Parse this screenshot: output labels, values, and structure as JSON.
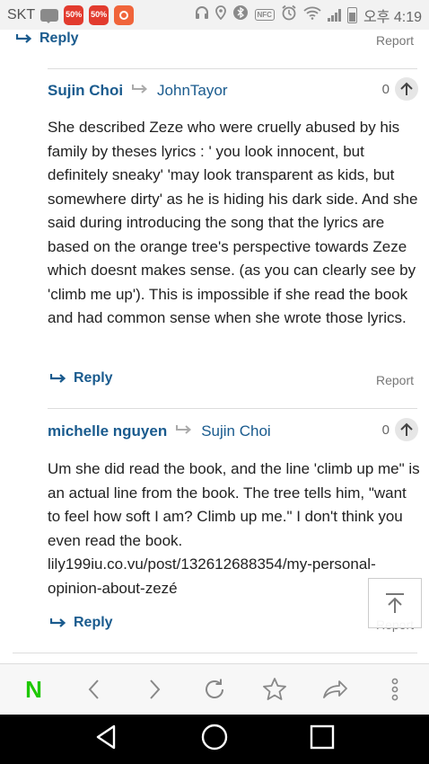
{
  "status_bar": {
    "carrier": "SKT",
    "badge1": "50%",
    "badge2": "50%",
    "nfc": "NFC",
    "ampm": "오후",
    "time": "4:19"
  },
  "thread": {
    "top_reply_label": "Reply",
    "top_report_label": "Report",
    "comments": [
      {
        "author": "Sujin Choi",
        "reply_to": "JohnTayor",
        "votes": "0",
        "body": "She described Zeze who were cruelly abused by his family by theses lyrics : ' you look innocent, but definitely sneaky' 'may look transparent as kids, but somewhere dirty' as he is hiding his dark side. And she said during introducing the song that the lyrics are based on the orange tree's perspective towards Zeze which doesnt makes sense. (as you can clearly see by 'climb me up'). This is impossible if she read the book and had common sense when she wrote those lyrics.",
        "reply_label": "Reply",
        "report_label": "Report"
      },
      {
        "author": "michelle nguyen",
        "reply_to": "Sujin Choi",
        "votes": "0",
        "body": "Um she did read the book, and the line 'climb up me\" is an actual line from the book. The tree tells him, \"want to feel how soft I am? Climb up me.\" I don't think you even read the book. lily199iu.co.vu/post/132612688354/my-personal-opinion-about-zezé",
        "reply_label": "Reply",
        "report_label": "Report"
      }
    ]
  },
  "toolbar": {
    "home_label": "N",
    "icons": [
      "naver-home-icon",
      "back-icon",
      "forward-icon",
      "refresh-icon",
      "bookmark-star-icon",
      "share-icon",
      "more-vert-icon"
    ]
  },
  "navbar": {
    "icons": [
      "nav-back-icon",
      "nav-home-icon",
      "nav-recents-icon"
    ]
  },
  "colors": {
    "link_blue": "#1a5b8e",
    "naver_green": "#1ec800",
    "text": "#222222",
    "muted": "#777777"
  }
}
